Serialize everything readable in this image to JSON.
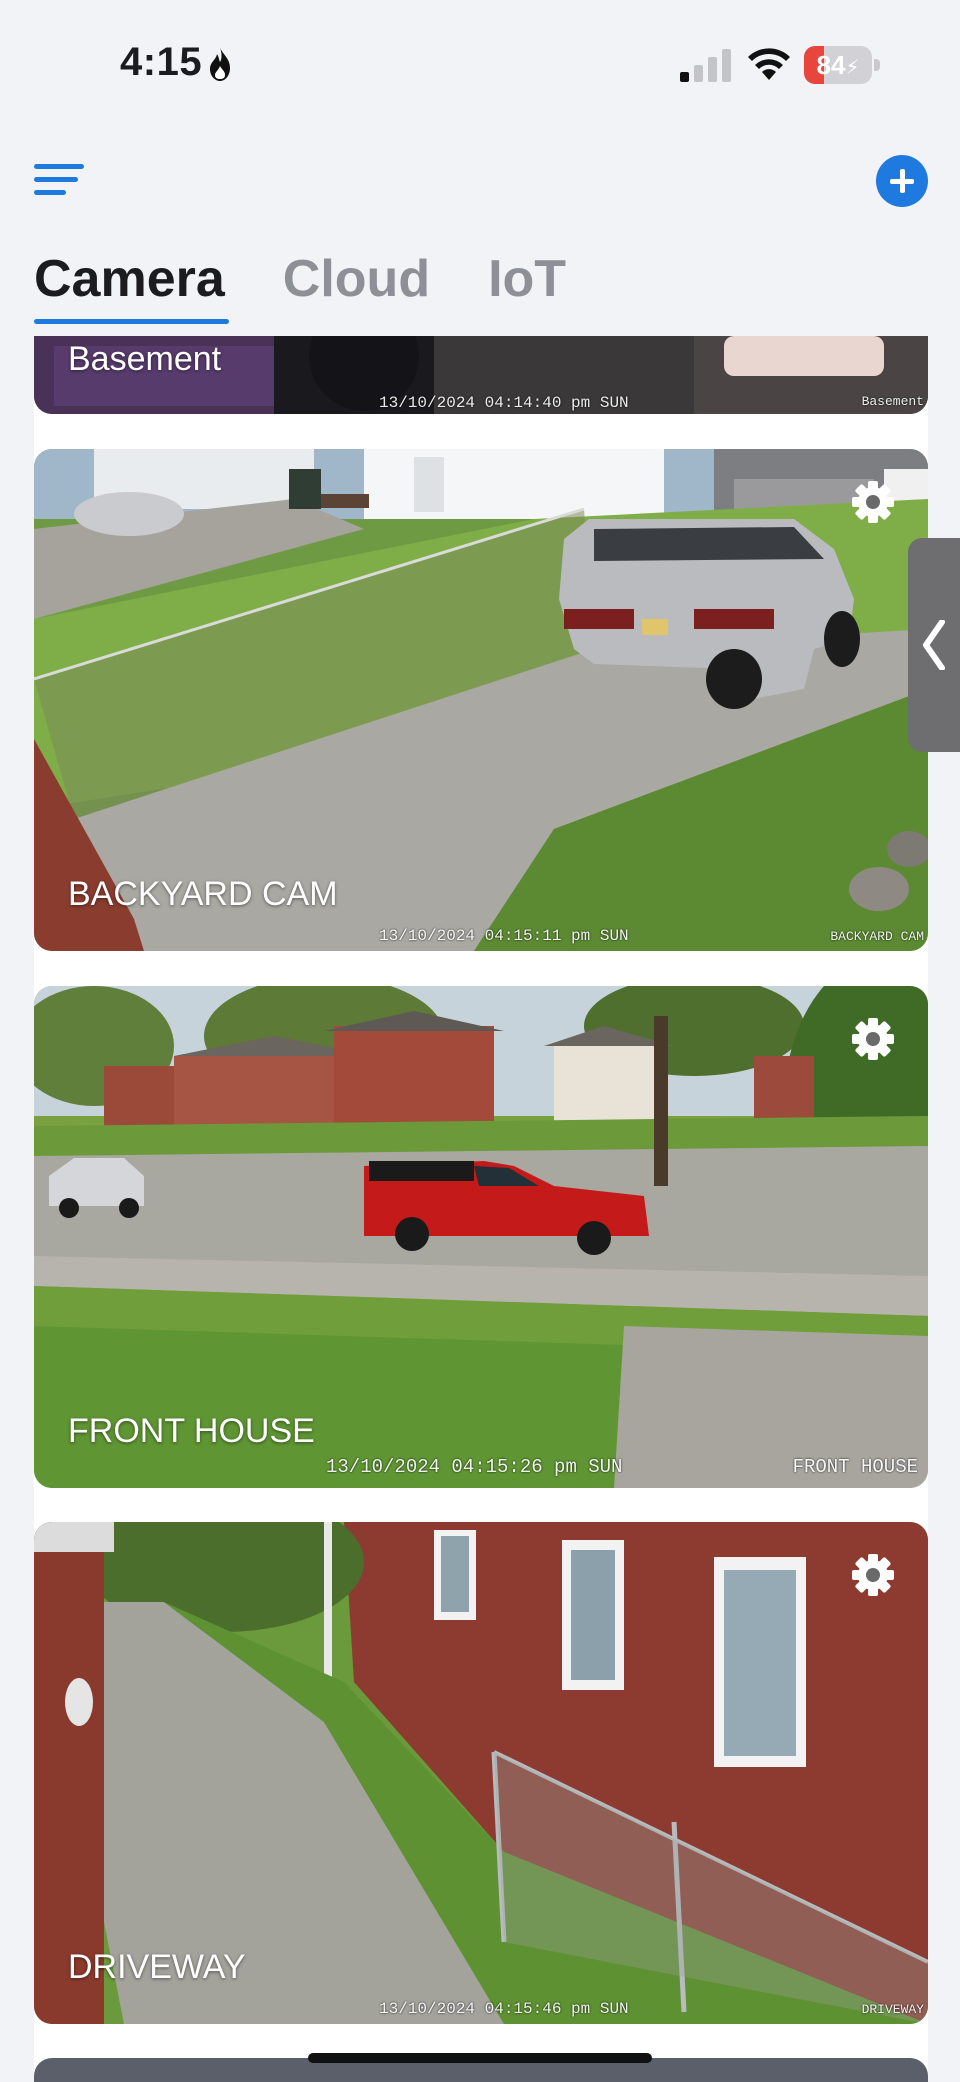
{
  "status_bar": {
    "time": "4:15",
    "battery_level": "84",
    "battery_percent_fraction": 0.3,
    "signal_bars_filled": 1,
    "signal_bars_total": 4
  },
  "header": {
    "menu_icon": "hamburger-menu-icon",
    "add_icon": "plus-circle-icon",
    "accent_color": "#1f7ae0"
  },
  "tabs": [
    {
      "label": "Camera",
      "active": true
    },
    {
      "label": "Cloud",
      "active": false
    },
    {
      "label": "IoT",
      "active": false
    }
  ],
  "cameras": [
    {
      "name": "Basement",
      "timestamp": "13/10/2024 04:14:40 pm SUN",
      "osd_name": "Basement",
      "settings_icon": "gear-icon"
    },
    {
      "name": "BACKYARD CAM",
      "timestamp": "13/10/2024 04:15:11 pm SUN",
      "osd_name": "BACKYARD CAM",
      "settings_icon": "gear-icon"
    },
    {
      "name": "FRONT HOUSE",
      "timestamp": "13/10/2024 04:15:26 pm SUN",
      "osd_name": "FRONT HOUSE",
      "settings_icon": "gear-icon"
    },
    {
      "name": "DRIVEWAY",
      "timestamp": "13/10/2024 04:15:46 pm SUN",
      "osd_name": "DRIVEWAY",
      "settings_icon": "gear-icon"
    }
  ],
  "side_panel": {
    "icon": "chevron-left-icon"
  }
}
